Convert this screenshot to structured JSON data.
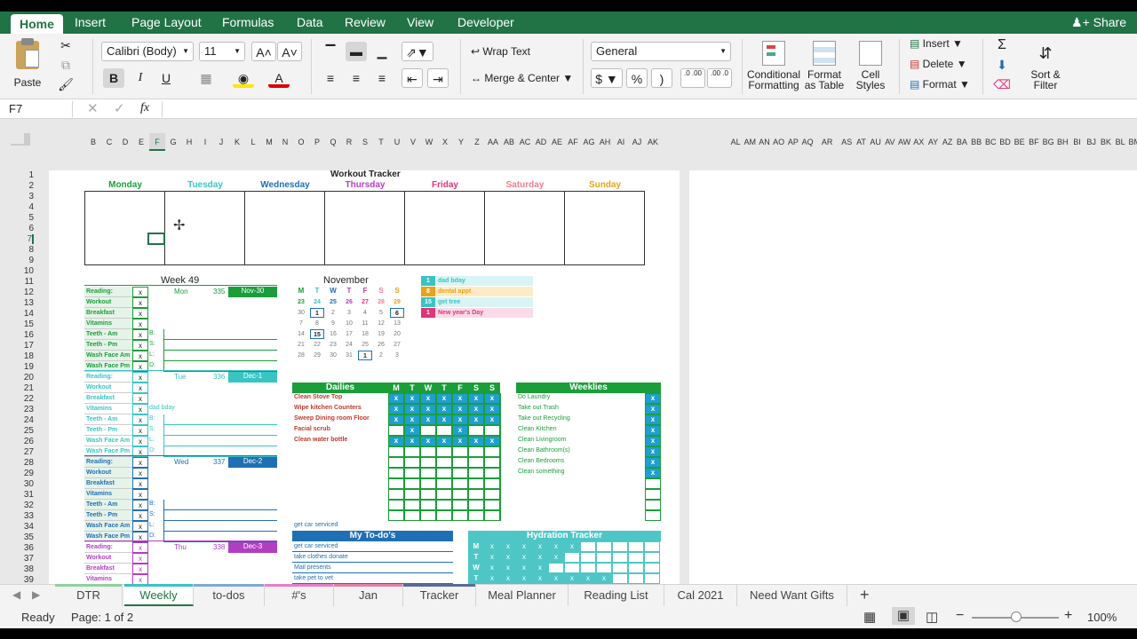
{
  "ribbon_tabs": [
    "Home",
    "Insert",
    "Page Layout",
    "Formulas",
    "Data",
    "Review",
    "View",
    "Developer"
  ],
  "share_label": "Share",
  "clipboard": {
    "paste": "Paste"
  },
  "font": {
    "name": "Calibri (Body)",
    "size": "11",
    "bold": "B",
    "italic": "I",
    "underline": "U",
    "grow": "A",
    "shrink": "A",
    "color_a": "A"
  },
  "alignment": {
    "wrap": "Wrap Text",
    "merge": "Merge & Center"
  },
  "number": {
    "format": "General",
    "currency": "$",
    "percent": "%",
    "comma": ")",
    "inc": ".0 .00",
    "dec": ".00 .0"
  },
  "styles": {
    "conditional": "Conditional Formatting",
    "format_table": "Format as Table",
    "cell_styles": "Cell Styles"
  },
  "cells": {
    "insert": "Insert",
    "delete": "Delete",
    "format": "Format"
  },
  "editing": {
    "sort": "Sort & Filter"
  },
  "formula_bar": {
    "name_box": "F7",
    "fx": "fx",
    "value": ""
  },
  "columns_left": [
    "B",
    "C",
    "D",
    "E",
    "F",
    "G",
    "H",
    "I",
    "J",
    "K",
    "L",
    "M",
    "N",
    "O",
    "P",
    "Q",
    "R",
    "S",
    "T",
    "U",
    "V",
    "W",
    "X",
    "Y",
    "Z",
    "AA",
    "AB",
    "AC",
    "AD",
    "AE",
    "AF",
    "AG",
    "AH",
    "AI",
    "AJ",
    "AK"
  ],
  "columns_right": [
    "AL",
    "AM",
    "AN",
    "AO",
    "AP",
    "AQ",
    "AR",
    "AS",
    "AT",
    "AU",
    "AV",
    "AW",
    "AX",
    "AY",
    "AZ",
    "BA",
    "BB",
    "BC",
    "BD",
    "BE",
    "BF",
    "BG",
    "BH",
    "BI",
    "BJ",
    "BK",
    "BL",
    "BM"
  ],
  "rows": [
    "1",
    "2",
    "3",
    "4",
    "5",
    "6",
    "7",
    "8",
    "9",
    "10",
    "11",
    "12",
    "13",
    "14",
    "15",
    "16",
    "17",
    "18",
    "19",
    "20",
    "21",
    "22",
    "23",
    "24",
    "25",
    "26",
    "27",
    "28",
    "29",
    "30",
    "31",
    "32",
    "33",
    "34",
    "35",
    "36",
    "37",
    "38",
    "39"
  ],
  "sheet": {
    "title": "Workout Tracker",
    "days": [
      {
        "n": "Monday",
        "c": "#1a9e3a"
      },
      {
        "n": "Tuesday",
        "c": "#39c4c4"
      },
      {
        "n": "Wednesday",
        "c": "#1f6fb5"
      },
      {
        "n": "Thursday",
        "c": "#b23ec2"
      },
      {
        "n": "Friday",
        "c": "#e0357a"
      },
      {
        "n": "Saturday",
        "c": "#ef7f8f"
      },
      {
        "n": "Sunday",
        "c": "#e8a317"
      }
    ],
    "week": "Week 49",
    "habits": [
      "Reading:",
      "Workout",
      "Breakfast",
      "Vitamins",
      "Teeth - Am",
      "Teeth - Pm",
      "Wash Face Am",
      "Wash Face Pm"
    ],
    "blocks": [
      {
        "day": "Mon",
        "num": "335",
        "date": "Nov-30",
        "c": "#1a9e3a",
        "letters": [
          "B:",
          "S:",
          "L:",
          "D:"
        ],
        "note": ""
      },
      {
        "day": "Tue",
        "num": "336",
        "date": "Dec-1",
        "c": "#39c4c4",
        "letters": [
          "B:",
          "S:",
          "L:",
          "D:"
        ],
        "note": "dad bday"
      },
      {
        "day": "Wed",
        "num": "337",
        "date": "Dec-2",
        "c": "#1f6fb5",
        "letters": [
          "B:",
          "S:",
          "L:",
          "D:"
        ],
        "note": ""
      },
      {
        "day": "Thu",
        "num": "338",
        "date": "Dec-3",
        "c": "#b23ec2",
        "letters": [],
        "note": ""
      }
    ],
    "x": "x",
    "cal_title": "November",
    "cal_head": [
      "M",
      "T",
      "W",
      "T",
      "F",
      "S",
      "S"
    ],
    "cal_rows": [
      [
        "23",
        "24",
        "25",
        "26",
        "27",
        "28",
        "29"
      ],
      [
        "30",
        "1",
        "2",
        "3",
        "4",
        "5",
        "6"
      ],
      [
        "7",
        "8",
        "9",
        "10",
        "11",
        "12",
        "13"
      ],
      [
        "14",
        "15",
        "16",
        "17",
        "18",
        "19",
        "20"
      ],
      [
        "21",
        "22",
        "23",
        "24",
        "25",
        "26",
        "27"
      ],
      [
        "28",
        "29",
        "30",
        "31",
        "1",
        "2",
        "3"
      ]
    ],
    "events": [
      {
        "n": "1",
        "t": "dad bday",
        "c": "#39c4c4",
        "bg": "#d8f4f4"
      },
      {
        "n": "8",
        "t": "dental appt",
        "c": "#e8a317",
        "bg": "#fcebc5"
      },
      {
        "n": "15",
        "t": "get tree",
        "c": "#39c4c4",
        "bg": "#d8f4f4"
      },
      {
        "n": "1",
        "t": "New year's Day",
        "c": "#e0357a",
        "bg": "#fbdbe8"
      }
    ],
    "dailies_title": "Dailies",
    "dailies_head": [
      "M",
      "T",
      "W",
      "T",
      "F",
      "S",
      "S"
    ],
    "dailies": [
      {
        "t": "Clean Stove Top",
        "m": [
          1,
          1,
          1,
          1,
          1,
          1,
          1
        ]
      },
      {
        "t": "Wipe kitchen Counters",
        "m": [
          1,
          1,
          1,
          1,
          1,
          1,
          1
        ]
      },
      {
        "t": "Sweep Dining room Floor",
        "m": [
          1,
          1,
          1,
          1,
          1,
          1,
          1
        ]
      },
      {
        "t": "Facial scrub",
        "m": [
          0,
          1,
          0,
          0,
          1,
          0,
          0
        ]
      },
      {
        "t": "Clean water bottle",
        "m": [
          1,
          1,
          1,
          1,
          1,
          1,
          1
        ]
      }
    ],
    "weeklies_title": "Weeklies",
    "weeklies": [
      "Do Laundry",
      "Take out Trash",
      "Take out Recycling",
      "Clean Kitchen",
      "Clean Livingroom",
      "Clean Bathroom(s)",
      "Clean Bedrooms",
      "Clean something"
    ],
    "above_todo": "get car serviced",
    "todo_title": "My To-do's",
    "todos": [
      "get car serviced",
      "take clothes donate",
      "Mail presents",
      "take pet to vet"
    ],
    "hydration_title": "Hydration Tracker",
    "hydration": [
      {
        "d": "M",
        "n": 6
      },
      {
        "d": "T",
        "n": 5
      },
      {
        "d": "W",
        "n": 4
      },
      {
        "d": "T",
        "n": 8
      }
    ]
  },
  "sheet_tabs": [
    {
      "n": "DTR",
      "c": "#8fd19e"
    },
    {
      "n": "Weekly",
      "c": "#39c4c4"
    },
    {
      "n": "to-dos",
      "c": "#7fa7d9"
    },
    {
      "n": "#'s",
      "c": "#e77fc6"
    },
    {
      "n": "Jan",
      "c": "#e77fa7"
    },
    {
      "n": "Tracker",
      "c": "#5a6b9a"
    },
    {
      "n": "Meal Planner",
      "c": ""
    },
    {
      "n": "Reading List",
      "c": ""
    },
    {
      "n": "Cal 2021",
      "c": ""
    },
    {
      "n": "Need Want Gifts",
      "c": ""
    }
  ],
  "status": {
    "ready": "Ready",
    "page": "Page: 1 of 2",
    "zoom": "100%"
  }
}
